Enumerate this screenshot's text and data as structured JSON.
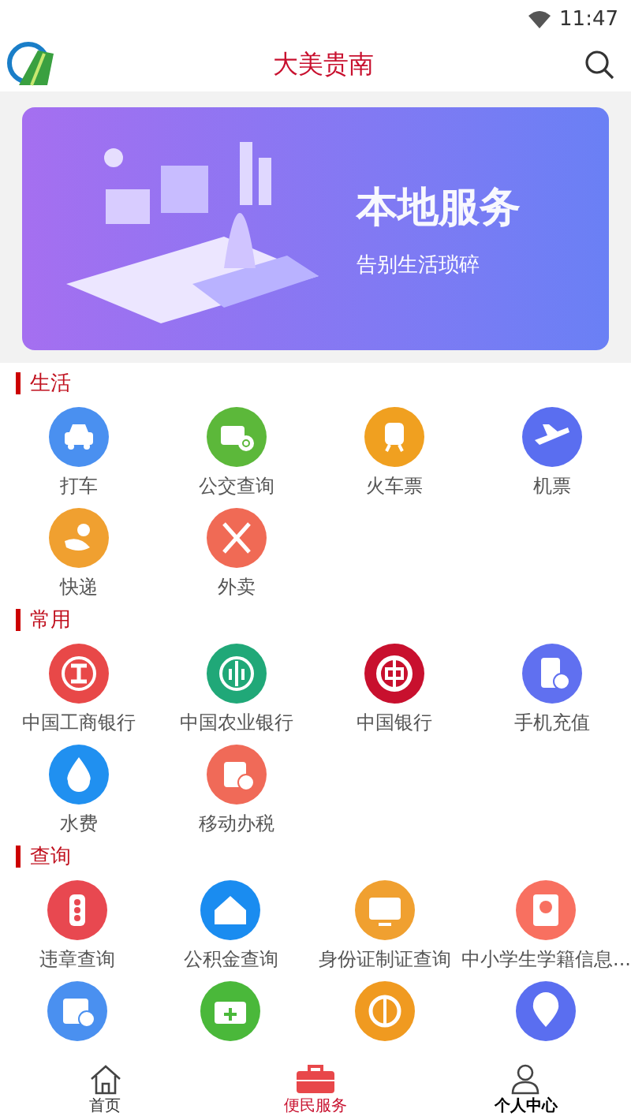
{
  "status_bar": {
    "time": "11:47"
  },
  "header": {
    "title": "大美贵南"
  },
  "banner": {
    "title": "本地服务",
    "subtitle": "告别生活琐碎"
  },
  "sections": [
    {
      "title": "生活",
      "items": [
        {
          "label": "打车",
          "color": "#4a90f0"
        },
        {
          "label": "公交查询",
          "color": "#5cb83a"
        },
        {
          "label": "火车票",
          "color": "#f0a020"
        },
        {
          "label": "机票",
          "color": "#5a6ef0"
        },
        {
          "label": "快递",
          "color": "#f0a030"
        },
        {
          "label": "外卖",
          "color": "#f06a55"
        }
      ]
    },
    {
      "title": "常用",
      "items": [
        {
          "label": "中国工商银行",
          "color": "#e84848"
        },
        {
          "label": "中国农业银行",
          "color": "#20a878"
        },
        {
          "label": "中国银行",
          "color": "#c8102e"
        },
        {
          "label": "手机充值",
          "color": "#6070f0"
        },
        {
          "label": "水费",
          "color": "#2090f0"
        },
        {
          "label": "移动办税",
          "color": "#f06a58"
        }
      ]
    },
    {
      "title": "查询",
      "items": [
        {
          "label": "违章查询",
          "color": "#e84850"
        },
        {
          "label": "公积金查询",
          "color": "#1a8cf0"
        },
        {
          "label": "身份证制证查询",
          "color": "#f0a030"
        },
        {
          "label": "中小学生学籍信息...",
          "color": "#f87060"
        },
        {
          "color": "#4a90f0"
        },
        {
          "color": "#4ab83a"
        },
        {
          "color": "#f09a20"
        },
        {
          "color": "#5a6ef0"
        }
      ]
    }
  ],
  "tabs": [
    {
      "label": "首页",
      "selected": false
    },
    {
      "label": "便民服务",
      "selected": true
    },
    {
      "label": "个人中心",
      "selected": false
    }
  ]
}
